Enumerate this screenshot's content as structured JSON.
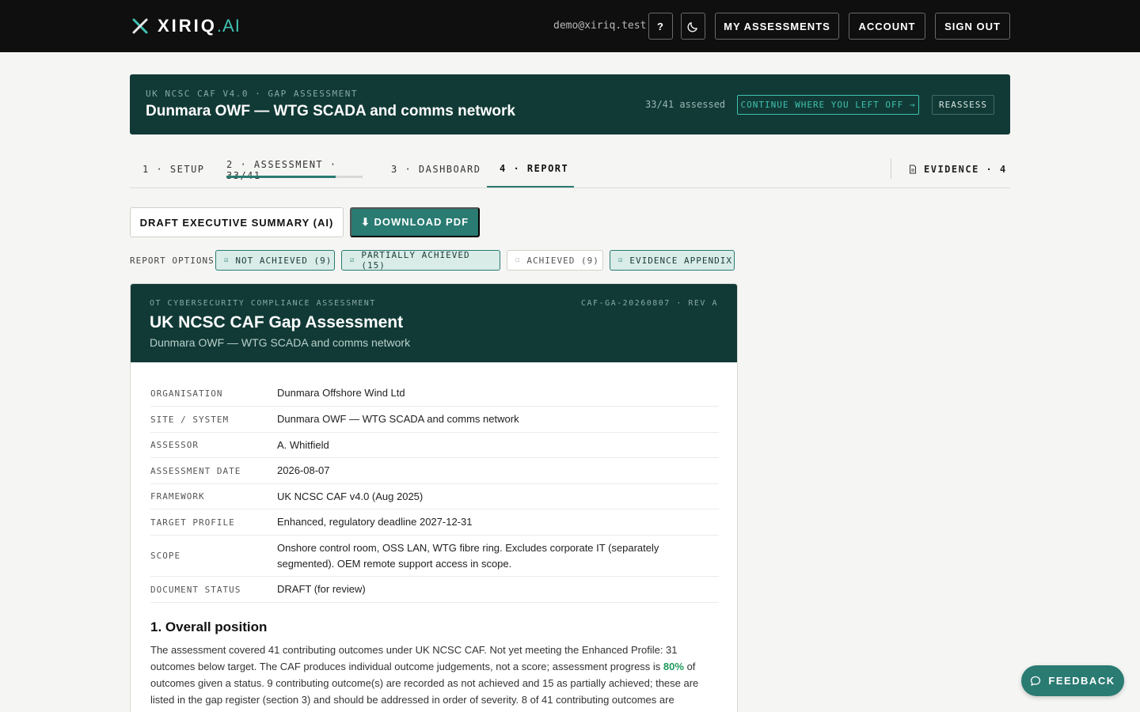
{
  "header": {
    "logo_text": "XIRIQ",
    "logo_suffix": ".AI",
    "user_email": "demo@xiriq.test",
    "help_label": "?",
    "my_assessments_label": "MY ASSESSMENTS",
    "account_label": "ACCOUNT",
    "sign_out_label": "SIGN OUT"
  },
  "banner": {
    "kicker": "UK NCSC CAF V4.0 · GAP ASSESSMENT",
    "title": "Dunmara OWF — WTG SCADA and comms network",
    "progress": "33/41 assessed",
    "continue_label": "CONTINUE WHERE YOU LEFT OFF →",
    "reassess_label": "REASSESS"
  },
  "steps": {
    "setup": "1 · SETUP",
    "assessment": "2 · ASSESSMENT · 33/41",
    "assessment_progress": 0.8,
    "dashboard": "3 · DASHBOARD",
    "report": "4 · REPORT",
    "evidence": "EVIDENCE · 4"
  },
  "actions": {
    "draft_summary_label": "DRAFT EXECUTIVE SUMMARY (AI)",
    "download_pdf_label": "⬇ DOWNLOAD PDF"
  },
  "report_options": {
    "label": "REPORT OPTIONS",
    "chips": [
      {
        "label": "NOT ACHIEVED (9)",
        "checked": true,
        "box": "☑"
      },
      {
        "label": "PARTIALLY ACHIEVED (15)",
        "checked": true,
        "box": "☑"
      },
      {
        "label": "ACHIEVED (9)",
        "checked": false,
        "box": "☐"
      },
      {
        "label": "EVIDENCE APPENDIX",
        "checked": true,
        "box": "☑"
      }
    ]
  },
  "report": {
    "kicker": "OT CYBERSECURITY COMPLIANCE ASSESSMENT",
    "reference": "CAF-GA-20260807 · REV A",
    "title": "UK NCSC CAF Gap Assessment",
    "subtitle": "Dunmara OWF — WTG SCADA and comms network",
    "meta": [
      {
        "key": "ORGANISATION",
        "value": "Dunmara Offshore Wind Ltd"
      },
      {
        "key": "SITE / SYSTEM",
        "value": "Dunmara OWF — WTG SCADA and comms network"
      },
      {
        "key": "ASSESSOR",
        "value": "A. Whitfield"
      },
      {
        "key": "ASSESSMENT DATE",
        "value": "2026-08-07"
      },
      {
        "key": "FRAMEWORK",
        "value": "UK NCSC CAF v4.0 (Aug 2025)"
      },
      {
        "key": "TARGET PROFILE",
        "value": "Enhanced, regulatory deadline 2027-12-31"
      },
      {
        "key": "SCOPE",
        "value": "Onshore control room, OSS LAN, WTG fibre ring. Excludes corporate IT (separately segmented). OEM remote support access in scope."
      },
      {
        "key": "DOCUMENT STATUS",
        "value": "DRAFT (for review)"
      }
    ],
    "section1_title": "1. Overall position",
    "section1_text_a": "The assessment covered 41 contributing outcomes under UK NCSC CAF. Not yet meeting the Enhanced Profile: 31 outcomes below target. The CAF produces individual outcome judgements, not a score; assessment progress is ",
    "section1_highlight": "80%",
    "section1_text_b": " of outcomes given a status. 9 contributing outcome(s) are recorded as not achieved and 15 as partially achieved; these are listed in the gap register (section 3) and should be addressed in order of severity. 8 of 41 contributing outcomes are"
  },
  "feedback_label": "FEEDBACK",
  "colors": {
    "accent": "#2a7b72",
    "banner": "#113a36",
    "highlight": "#1f9a5e"
  }
}
